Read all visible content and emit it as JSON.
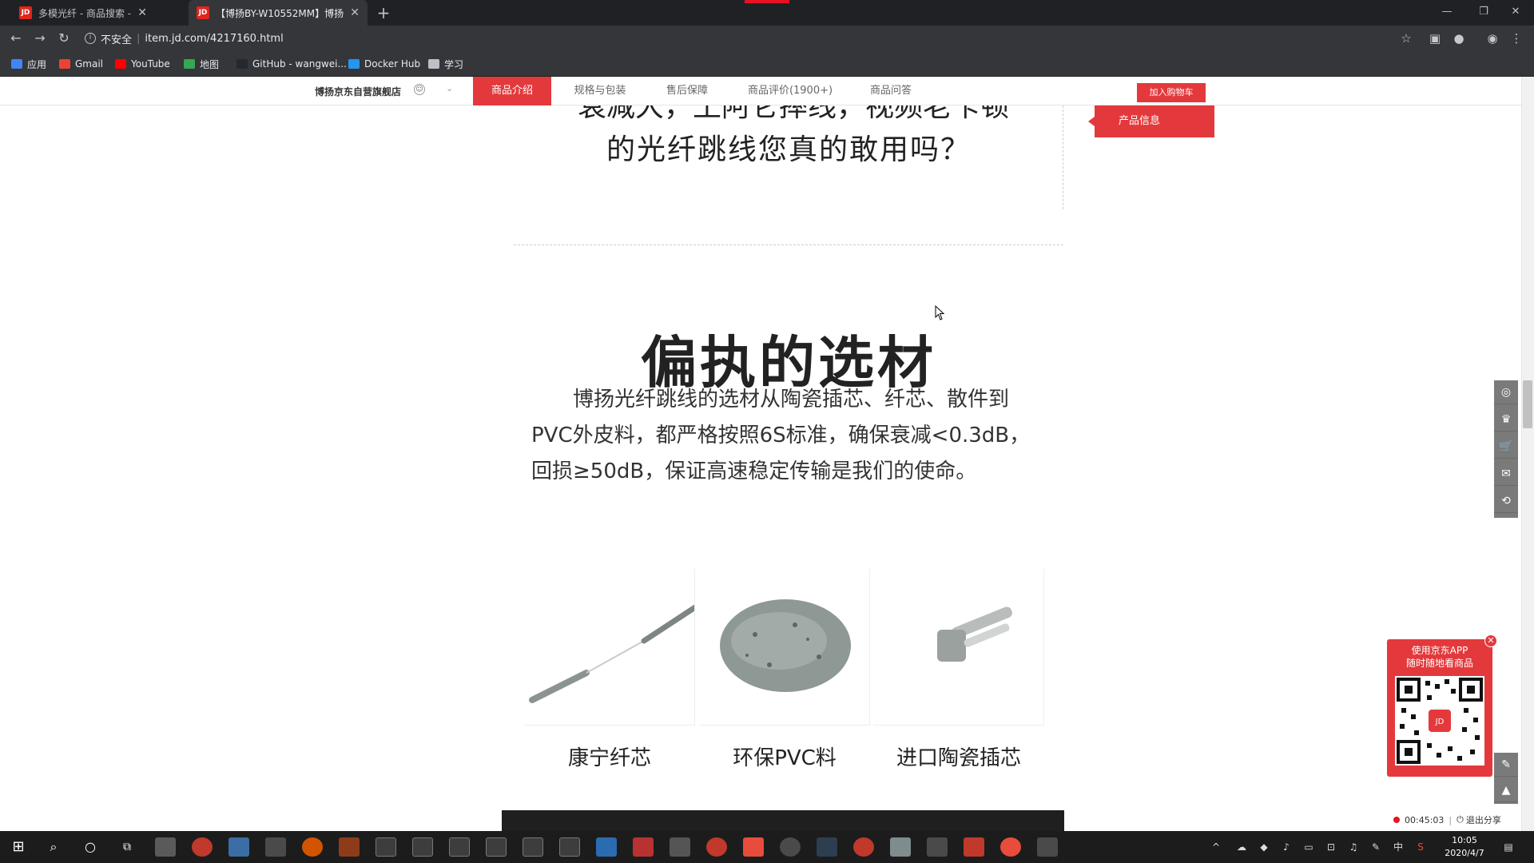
{
  "browser": {
    "tabs": [
      {
        "favicon": "JD",
        "title": "多模光纤 - 商品搜索 - 京东",
        "active": false
      },
      {
        "favicon": "JD",
        "title": "【博扬BY-W10552MM】博扬",
        "active": true
      }
    ],
    "new_tab": "+",
    "window_controls": {
      "minimize": "—",
      "restore": "❐",
      "close": "✕"
    },
    "address": {
      "security": "不安全",
      "url": "item.jd.com/4217160.html"
    },
    "bookmarks": [
      {
        "label": "应用",
        "icon": "apps-grid-icon",
        "color": "#4285f4"
      },
      {
        "label": "Gmail",
        "icon": "gmail-icon",
        "color": "#ea4335"
      },
      {
        "label": "YouTube",
        "icon": "youtube-icon",
        "color": "#ff0000"
      },
      {
        "label": "地图",
        "icon": "maps-icon",
        "color": "#34a853"
      },
      {
        "label": "GitHub - wangwei...",
        "icon": "github-icon",
        "color": "#24292e"
      },
      {
        "label": "Docker Hub",
        "icon": "docker-icon",
        "color": "#2496ed"
      },
      {
        "label": "学习",
        "icon": "folder-icon",
        "color": "#bdc1c6"
      }
    ]
  },
  "product_nav": {
    "shop_name": "博扬京东自营旗舰店",
    "tabs": [
      "商品介绍",
      "规格与包装",
      "售后保障",
      "商品评价(1900+)",
      "商品问答"
    ],
    "active_tab": 0,
    "add_to_cart": "加入购物车",
    "info_tag": "产品信息"
  },
  "content": {
    "top_partial": "衰减大，土阿仑摔线，视频老卡顿",
    "top_headline": "的光纤跳线您真的敢用吗？",
    "section_title": "偏执的选材",
    "section_body": "博扬光纤跳线的选材从陶瓷插芯、纤芯、散件到PVC外皮料，都严格按照6S标准，确保衰减<0.3dB，回损≥50dB，保证高速稳定传输是我们的使命。",
    "materials": [
      {
        "label": "康宁纤芯",
        "image": "fiber-core-image"
      },
      {
        "label": "环保PVC料",
        "image": "pvc-pellets-image"
      },
      {
        "label": "进口陶瓷插芯",
        "image": "ceramic-ferrule-image"
      }
    ]
  },
  "qr_popup": {
    "line1": "使用京东APP",
    "line2": "随时随地看商品"
  },
  "recording": {
    "elapsed": "00:45:03",
    "exit_label": "退出分享"
  },
  "taskbar": {
    "time": "10:05",
    "date": "2020/4/7",
    "ime": "中"
  },
  "colors": {
    "jd_red": "#e4393c",
    "chrome_dark": "#35363a",
    "tab_strip": "#202124",
    "taskbar": "#1c1c1c"
  }
}
